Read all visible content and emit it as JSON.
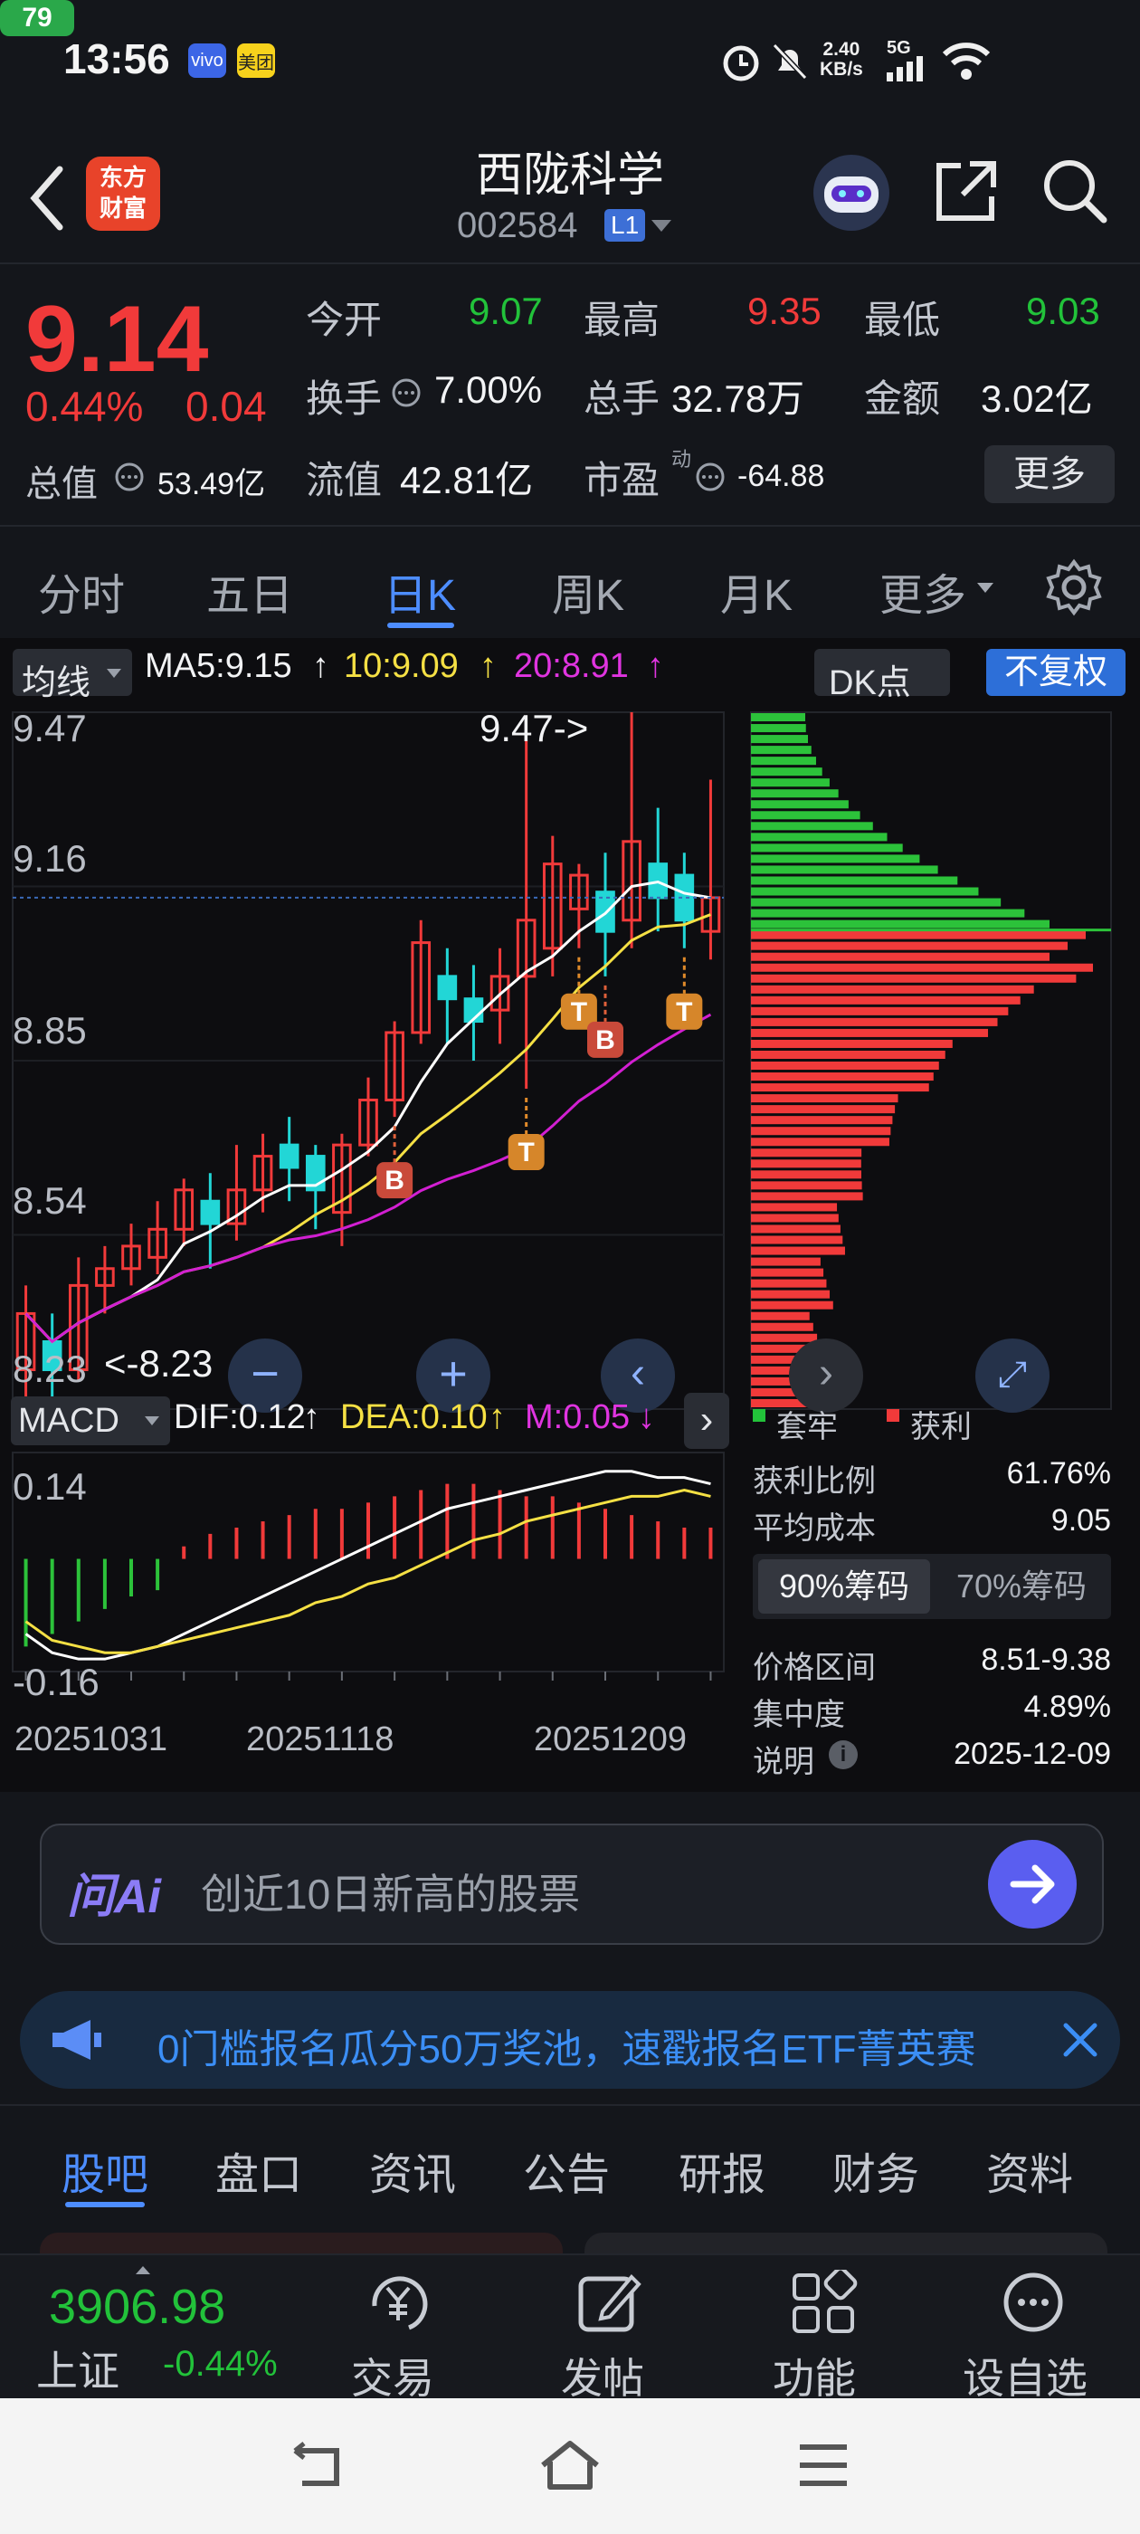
{
  "status_bar": {
    "time": "13:56",
    "app_badges": [
      "vivo",
      "美团"
    ],
    "net_speed": "2.40\nKB/s",
    "net_speed_top": "2.40",
    "net_speed_bottom": "KB/s",
    "signal": "5G",
    "battery": "79",
    "icons": [
      "alarm-icon",
      "mute-icon",
      "signal-icon",
      "wifi-icon"
    ]
  },
  "header": {
    "logo_text": "东方\n财富",
    "logo_line1": "东方",
    "logo_line2": "财富",
    "title": "西陇科学",
    "code": "002584",
    "level_badge": "L1"
  },
  "quote": {
    "price": "9.14",
    "change_pct": "0.44%",
    "change": "0.04",
    "open_label": "今开",
    "open": "9.07",
    "high_label": "最高",
    "high": "9.35",
    "low_label": "最低",
    "low": "9.03",
    "turnover_label": "换手",
    "turnover": "7.00%",
    "volume_label": "总手",
    "volume": "32.78万",
    "amount_label": "金额",
    "amount": "3.02亿",
    "mktcap_label": "总值",
    "mktcap": "53.49亿",
    "float_label": "流值",
    "float": "42.81亿",
    "pe_label": "市盈",
    "pe_sup": "动",
    "pe": "-64.88",
    "more_button": "更多"
  },
  "tabs": {
    "items": [
      "分时",
      "五日",
      "日K",
      "周K",
      "月K",
      "更多"
    ],
    "active": "日K"
  },
  "chart_controls": {
    "ma_selector": "均线",
    "ma5": "MA5:9.15",
    "ma10": "10:9.09",
    "ma20": "20:8.91",
    "dk_selector": "DK点",
    "adjust_button": "不复权",
    "macd_selector": "MACD",
    "dif": "DIF:0.12",
    "dea": "DEA:0.10",
    "m": "M:0.05"
  },
  "chart_data": [
    {
      "type": "candlestick",
      "ylim": [
        8.23,
        9.47
      ],
      "y_ticks": [
        "9.47",
        "9.16",
        "8.85",
        "8.54",
        "8.23"
      ],
      "annotations": [
        "9.47->",
        "<-8.23"
      ],
      "markers": [
        "B",
        "T",
        "T",
        "B",
        "T"
      ],
      "marker_colors": {
        "up": "#f13a3a",
        "down": "#22d6d6",
        "ma5": "#ffffff",
        "ma10": "#f5e044",
        "ma20": "#d21fd2"
      },
      "candles": [
        {
          "o": 8.3,
          "c": 8.4,
          "h": 8.45,
          "l": 8.25
        },
        {
          "o": 8.35,
          "c": 8.3,
          "h": 8.4,
          "l": 8.23
        },
        {
          "o": 8.3,
          "c": 8.45,
          "h": 8.5,
          "l": 8.28
        },
        {
          "o": 8.45,
          "c": 8.48,
          "h": 8.52,
          "l": 8.4
        },
        {
          "o": 8.48,
          "c": 8.52,
          "h": 8.56,
          "l": 8.45
        },
        {
          "o": 8.5,
          "c": 8.55,
          "h": 8.6,
          "l": 8.47
        },
        {
          "o": 8.55,
          "c": 8.62,
          "h": 8.64,
          "l": 8.52
        },
        {
          "o": 8.6,
          "c": 8.56,
          "h": 8.65,
          "l": 8.48
        },
        {
          "o": 8.56,
          "c": 8.62,
          "h": 8.7,
          "l": 8.53
        },
        {
          "o": 8.62,
          "c": 8.68,
          "h": 8.72,
          "l": 8.58
        },
        {
          "o": 8.7,
          "c": 8.66,
          "h": 8.75,
          "l": 8.6
        },
        {
          "o": 8.68,
          "c": 8.62,
          "h": 8.7,
          "l": 8.55
        },
        {
          "o": 8.58,
          "c": 8.7,
          "h": 8.72,
          "l": 8.52
        },
        {
          "o": 8.7,
          "c": 8.78,
          "h": 8.82,
          "l": 8.68
        },
        {
          "o": 8.78,
          "c": 8.9,
          "h": 8.92,
          "l": 8.75
        },
        {
          "o": 8.9,
          "c": 9.06,
          "h": 9.1,
          "l": 8.88
        },
        {
          "o": 9.0,
          "c": 8.96,
          "h": 9.05,
          "l": 8.88
        },
        {
          "o": 8.96,
          "c": 8.92,
          "h": 9.02,
          "l": 8.85
        },
        {
          "o": 8.94,
          "c": 9.0,
          "h": 9.05,
          "l": 8.88
        },
        {
          "o": 9.0,
          "c": 9.1,
          "h": 9.42,
          "l": 8.8
        },
        {
          "o": 9.05,
          "c": 9.2,
          "h": 9.25,
          "l": 9.0
        },
        {
          "o": 9.12,
          "c": 9.18,
          "h": 9.2,
          "l": 9.05
        },
        {
          "o": 9.15,
          "c": 9.08,
          "h": 9.22,
          "l": 9.0
        },
        {
          "o": 9.1,
          "c": 9.24,
          "h": 9.47,
          "l": 9.05
        },
        {
          "o": 9.2,
          "c": 9.14,
          "h": 9.3,
          "l": 9.08
        },
        {
          "o": 9.18,
          "c": 9.1,
          "h": 9.22,
          "l": 9.05
        },
        {
          "o": 9.08,
          "c": 9.14,
          "h": 9.35,
          "l": 9.03
        }
      ]
    },
    {
      "type": "bar",
      "title": "MACD",
      "x_ticks": [
        "20251031",
        "20251118",
        "20251209"
      ],
      "y_ticks": [
        "0.14",
        "-0.16"
      ],
      "values": [
        -0.14,
        -0.12,
        -0.1,
        -0.08,
        -0.06,
        -0.05,
        0.02,
        0.04,
        0.05,
        0.06,
        0.07,
        0.08,
        0.08,
        0.09,
        0.1,
        0.11,
        0.12,
        0.12,
        0.11,
        0.1,
        0.1,
        0.09,
        0.08,
        0.07,
        0.06,
        0.05,
        0.05
      ],
      "dif": [
        -0.12,
        -0.15,
        -0.16,
        -0.16,
        -0.15,
        -0.14,
        -0.12,
        -0.1,
        -0.08,
        -0.06,
        -0.04,
        -0.02,
        0.0,
        0.02,
        0.04,
        0.06,
        0.08,
        0.09,
        0.1,
        0.11,
        0.12,
        0.13,
        0.14,
        0.14,
        0.13,
        0.13,
        0.12
      ],
      "dea": [
        -0.1,
        -0.13,
        -0.14,
        -0.15,
        -0.15,
        -0.14,
        -0.13,
        -0.12,
        -0.11,
        -0.1,
        -0.09,
        -0.07,
        -0.06,
        -0.04,
        -0.03,
        -0.01,
        0.01,
        0.03,
        0.04,
        0.06,
        0.07,
        0.08,
        0.09,
        0.1,
        0.1,
        0.11,
        0.1
      ]
    }
  ],
  "chip_panel": {
    "legend_hold": "套牢",
    "legend_profit": "获利",
    "profit_ratio_label": "获利比例",
    "profit_ratio": "61.76%",
    "avg_cost_label": "平均成本",
    "avg_cost": "9.05",
    "tab_90": "90%筹码",
    "tab_70": "70%筹码",
    "range_label": "价格区间",
    "range": "8.51-9.38",
    "concentration_label": "集中度",
    "concentration": "4.89%",
    "note_label": "说明",
    "note_date": "2025-12-09"
  },
  "ai_search": {
    "brand": "问Ai",
    "placeholder": "创近10日新高的股票"
  },
  "banner": {
    "text": "0门槛报名瓜分50万奖池，速戳报名ETF菁英赛"
  },
  "sub_tabs": {
    "items": [
      "股吧",
      "盘口",
      "资讯",
      "公告",
      "研报",
      "财务",
      "资料"
    ],
    "active": "股吧"
  },
  "bottom_bar": {
    "index_value": "3906.98",
    "index_name": "上证",
    "index_change": "-0.44%",
    "items": [
      "交易",
      "发帖",
      "功能",
      "设自选"
    ]
  }
}
